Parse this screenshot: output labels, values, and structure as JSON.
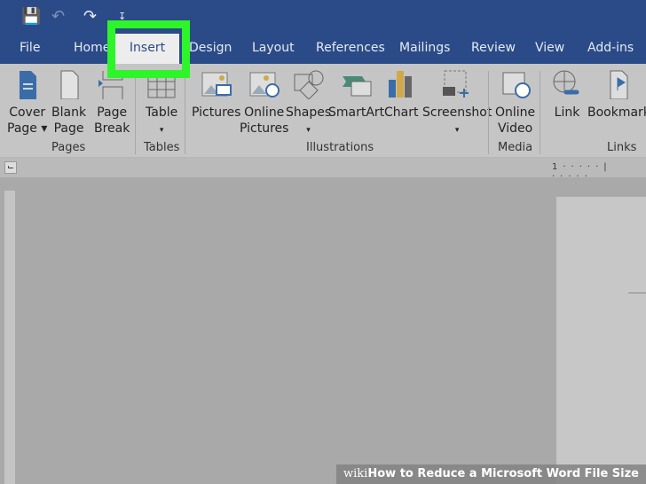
{
  "quick_access": {
    "save_icon": "save-icon",
    "undo_icon": "undo-icon",
    "redo_icon": "redo-icon",
    "customize_icon": "customize-icon"
  },
  "tabs": [
    "File",
    "Home",
    "Insert",
    "Design",
    "Layout",
    "References",
    "Mailings",
    "Review",
    "View",
    "Add-ins"
  ],
  "ribbon": {
    "buttons": [
      {
        "l1": "Cover",
        "l2": "Page ▾"
      },
      {
        "l1": "Blank",
        "l2": "Page"
      },
      {
        "l1": "Page",
        "l2": "Break"
      },
      {
        "l1": "Table",
        "l2": "▾"
      },
      {
        "l1": "Pictures",
        "l2": ""
      },
      {
        "l1": "Online",
        "l2": "Pictures"
      },
      {
        "l1": "Shapes",
        "l2": "▾"
      },
      {
        "l1": "SmartArt",
        "l2": ""
      },
      {
        "l1": "Chart",
        "l2": ""
      },
      {
        "l1": "Screenshot",
        "l2": "▾"
      },
      {
        "l1": "Online",
        "l2": "Video"
      },
      {
        "l1": "Link",
        "l2": ""
      },
      {
        "l1": "Bookmark",
        "l2": ""
      }
    ],
    "groups": [
      "Pages",
      "Tables",
      "Illustrations",
      "Media",
      "Links"
    ]
  },
  "ruler": {
    "label": "1"
  },
  "watermark": {
    "brand": "wiki",
    "text": "How to Reduce a Microsoft Word File Size"
  },
  "colors": {
    "titlebar": "#2a4b88",
    "highlight": "#2ef52a",
    "ribbon": "#c5c5c5"
  }
}
